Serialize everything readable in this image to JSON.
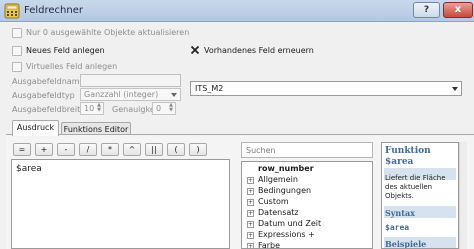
{
  "window": {
    "title": "Feldrechner",
    "help_label": "?",
    "close_label": "x"
  },
  "options": {
    "only_selected": "Nur 0 ausgewählte Objekte aktualisieren",
    "new_field": "Neues Feld anlegen",
    "update_existing": "Vorhandenes Feld erneuern",
    "virtual_field": "Virtuelles Feld anlegen"
  },
  "new_field_form": {
    "name_label": "Ausgabefeldname",
    "name_value": "",
    "type_label": "Ausgabefeldtyp",
    "type_value": "Ganzzahl (integer)",
    "width_label": "Ausgabefeldbreite",
    "width_value": "10",
    "precision_label": "Genauigkeit",
    "precision_value": "0"
  },
  "existing_field": {
    "value": "ITS_M2"
  },
  "tabs": [
    {
      "label": "Ausdruck",
      "active": true
    },
    {
      "label": "Funktions Editor",
      "active": false
    }
  ],
  "operators": [
    "=",
    "+",
    "-",
    "/",
    "*",
    "^",
    "||",
    "(",
    ")"
  ],
  "expression": {
    "value": "$area"
  },
  "search": {
    "placeholder": "Suchen"
  },
  "function_tree": [
    {
      "label": "row_number",
      "bold": true,
      "expandable": false
    },
    {
      "label": "Allgemein",
      "bold": false,
      "expandable": true
    },
    {
      "label": "Bedingungen",
      "bold": false,
      "expandable": true
    },
    {
      "label": "Custom",
      "bold": false,
      "expandable": true
    },
    {
      "label": "Datensatz",
      "bold": false,
      "expandable": true
    },
    {
      "label": "Datum und Zeit",
      "bold": false,
      "expandable": true
    },
    {
      "label": "Expressions +",
      "bold": false,
      "expandable": true
    },
    {
      "label": "Farbe",
      "bold": false,
      "expandable": true
    }
  ],
  "help": {
    "heading": "Funktion",
    "function_name": "$area",
    "description": "Liefert die Fläche des aktuellen Objekts.",
    "syntax_heading": "Syntax",
    "syntax": "$area",
    "examples_heading": "Beispiele"
  },
  "colors": {
    "titlebar": "#c9d8ec",
    "accent": "#3e6b94",
    "help_bar": "#d6e3ef",
    "close": "#c64b3a"
  }
}
